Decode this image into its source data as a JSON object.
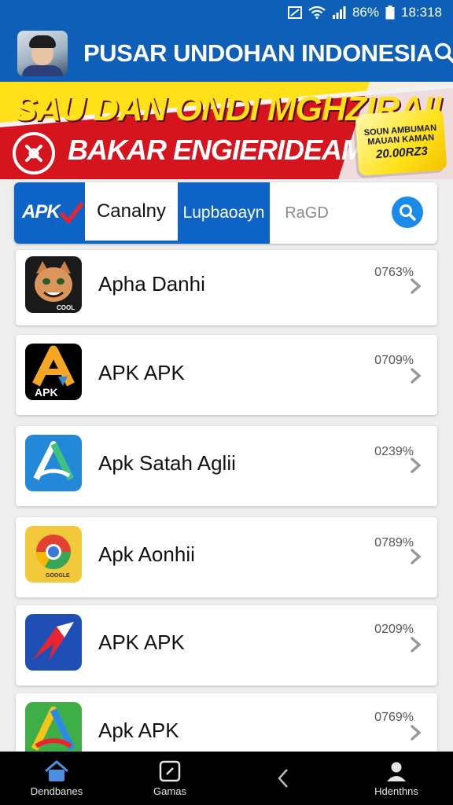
{
  "status_bar": {
    "battery": "86%",
    "time": "18:318"
  },
  "app_bar": {
    "title": "PUSAR UNDOHAN INDONESIA"
  },
  "banner": {
    "headline": "SAU DAN ONDI MGHZIRAII",
    "subline": "BAKAR ENGIERIDEAM!",
    "sticker_text": "SOUN AMBUMAN MAUAN KAMAN",
    "sticker_amount": "20.00RZ3"
  },
  "tabs": {
    "logo": "APK",
    "items": [
      {
        "label": "Canalny"
      },
      {
        "label": "Lupbaoayn"
      },
      {
        "label": "RaGD"
      }
    ]
  },
  "apps": [
    {
      "name": "Apha Danhi",
      "percent": "0763%",
      "icon": "cat-face-icon",
      "icon_caption": "COOL"
    },
    {
      "name": "APK APK",
      "percent": "0709%",
      "icon": "apk-a-icon",
      "icon_caption": "APK"
    },
    {
      "name": "Apk Satah Aglii",
      "percent": "0239%",
      "icon": "blue-a-icon"
    },
    {
      "name": "Apk Aonhii",
      "percent": "0789%",
      "icon": "chrome-like-icon",
      "icon_caption": "GOOGLE"
    },
    {
      "name": "APK APK",
      "percent": "0209%",
      "icon": "red-bird-icon"
    },
    {
      "name": "Apk APK",
      "percent": "0769%",
      "icon": "green-a-icon"
    }
  ],
  "bottom_nav": {
    "items": [
      {
        "label": "Dendbanes",
        "icon": "home-icon"
      },
      {
        "label": "Gamas",
        "icon": "games-icon"
      },
      {
        "label": "",
        "icon": "back-chevron-icon"
      },
      {
        "label": "Hdenthns",
        "icon": "profile-icon"
      }
    ]
  },
  "colors": {
    "primary": "#0d5fb8",
    "banner_red": "#d6141e",
    "banner_yellow": "#ffe11a"
  }
}
